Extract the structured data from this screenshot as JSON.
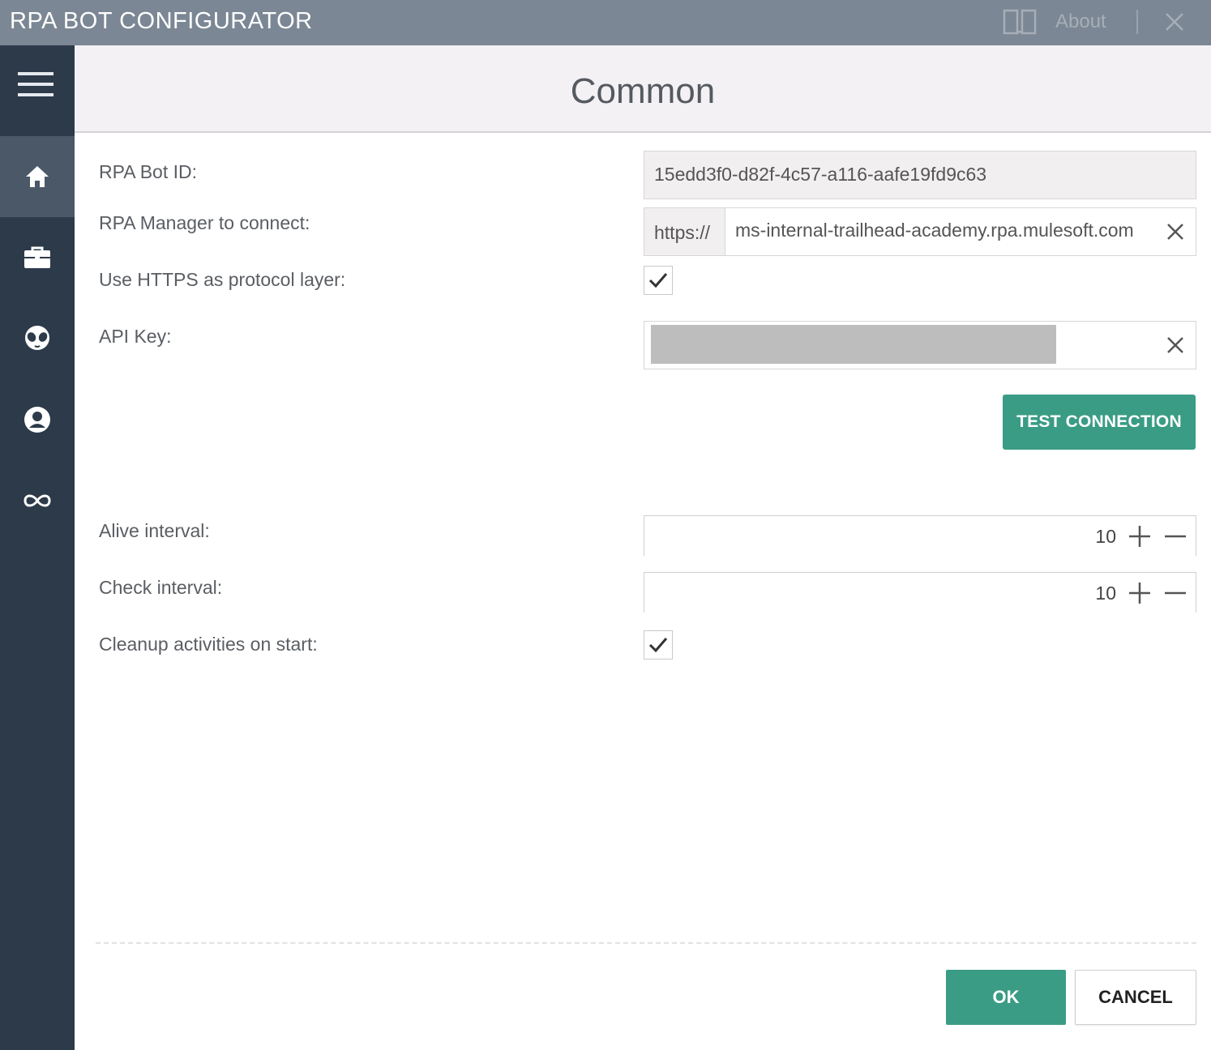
{
  "titlebar": {
    "title": "RPA BOT CONFIGURATOR",
    "about_label": "About",
    "help_icon": "book-icon",
    "close_icon": "close-icon"
  },
  "sidebar": {
    "menu_icon": "hamburger-menu-icon",
    "items": [
      {
        "icon": "home-icon",
        "active": true
      },
      {
        "icon": "briefcase-icon",
        "active": false
      },
      {
        "icon": "alien-icon",
        "active": false
      },
      {
        "icon": "user-circle-icon",
        "active": false
      },
      {
        "icon": "infinity-icon",
        "active": false
      }
    ]
  },
  "header": {
    "title": "Common"
  },
  "form": {
    "bot_id": {
      "label": "RPA Bot ID:",
      "value": "15edd3f0-d82f-4c57-a116-aafe19fd9c63"
    },
    "manager": {
      "label": "RPA Manager to connect:",
      "prefix": "https://",
      "value": "ms-internal-trailhead-academy.rpa.mulesoft.com"
    },
    "use_https": {
      "label": "Use HTTPS as protocol layer:",
      "checked": true
    },
    "api_key": {
      "label": "API Key:",
      "value_redacted": true
    },
    "test_connection_label": "TEST CONNECTION",
    "alive_interval": {
      "label": "Alive interval:",
      "value": "10"
    },
    "check_interval": {
      "label": "Check interval:",
      "value": "10"
    },
    "cleanup": {
      "label": "Cleanup activities on start:",
      "checked": true
    }
  },
  "footer": {
    "ok_label": "OK",
    "cancel_label": "CANCEL"
  },
  "colors": {
    "titlebar": "#7b8794",
    "sidebar": "#2c3a4a",
    "sidebar_active": "#4a5868",
    "accent": "#3a9c84",
    "header_bg": "#f4f1f4"
  }
}
